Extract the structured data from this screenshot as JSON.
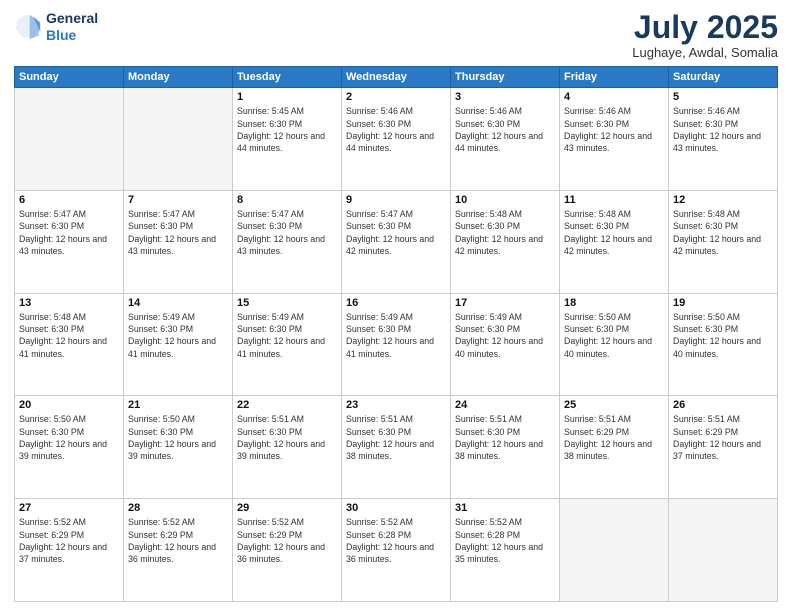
{
  "header": {
    "logo_general": "General",
    "logo_blue": "Blue",
    "month_title": "July 2025",
    "location": "Lughaye, Awdal, Somalia"
  },
  "days_of_week": [
    "Sunday",
    "Monday",
    "Tuesday",
    "Wednesday",
    "Thursday",
    "Friday",
    "Saturday"
  ],
  "weeks": [
    [
      {
        "day": "",
        "info": ""
      },
      {
        "day": "",
        "info": ""
      },
      {
        "day": "1",
        "info": "Sunrise: 5:45 AM\nSunset: 6:30 PM\nDaylight: 12 hours and 44 minutes."
      },
      {
        "day": "2",
        "info": "Sunrise: 5:46 AM\nSunset: 6:30 PM\nDaylight: 12 hours and 44 minutes."
      },
      {
        "day": "3",
        "info": "Sunrise: 5:46 AM\nSunset: 6:30 PM\nDaylight: 12 hours and 44 minutes."
      },
      {
        "day": "4",
        "info": "Sunrise: 5:46 AM\nSunset: 6:30 PM\nDaylight: 12 hours and 43 minutes."
      },
      {
        "day": "5",
        "info": "Sunrise: 5:46 AM\nSunset: 6:30 PM\nDaylight: 12 hours and 43 minutes."
      }
    ],
    [
      {
        "day": "6",
        "info": "Sunrise: 5:47 AM\nSunset: 6:30 PM\nDaylight: 12 hours and 43 minutes."
      },
      {
        "day": "7",
        "info": "Sunrise: 5:47 AM\nSunset: 6:30 PM\nDaylight: 12 hours and 43 minutes."
      },
      {
        "day": "8",
        "info": "Sunrise: 5:47 AM\nSunset: 6:30 PM\nDaylight: 12 hours and 43 minutes."
      },
      {
        "day": "9",
        "info": "Sunrise: 5:47 AM\nSunset: 6:30 PM\nDaylight: 12 hours and 42 minutes."
      },
      {
        "day": "10",
        "info": "Sunrise: 5:48 AM\nSunset: 6:30 PM\nDaylight: 12 hours and 42 minutes."
      },
      {
        "day": "11",
        "info": "Sunrise: 5:48 AM\nSunset: 6:30 PM\nDaylight: 12 hours and 42 minutes."
      },
      {
        "day": "12",
        "info": "Sunrise: 5:48 AM\nSunset: 6:30 PM\nDaylight: 12 hours and 42 minutes."
      }
    ],
    [
      {
        "day": "13",
        "info": "Sunrise: 5:48 AM\nSunset: 6:30 PM\nDaylight: 12 hours and 41 minutes."
      },
      {
        "day": "14",
        "info": "Sunrise: 5:49 AM\nSunset: 6:30 PM\nDaylight: 12 hours and 41 minutes."
      },
      {
        "day": "15",
        "info": "Sunrise: 5:49 AM\nSunset: 6:30 PM\nDaylight: 12 hours and 41 minutes."
      },
      {
        "day": "16",
        "info": "Sunrise: 5:49 AM\nSunset: 6:30 PM\nDaylight: 12 hours and 41 minutes."
      },
      {
        "day": "17",
        "info": "Sunrise: 5:49 AM\nSunset: 6:30 PM\nDaylight: 12 hours and 40 minutes."
      },
      {
        "day": "18",
        "info": "Sunrise: 5:50 AM\nSunset: 6:30 PM\nDaylight: 12 hours and 40 minutes."
      },
      {
        "day": "19",
        "info": "Sunrise: 5:50 AM\nSunset: 6:30 PM\nDaylight: 12 hours and 40 minutes."
      }
    ],
    [
      {
        "day": "20",
        "info": "Sunrise: 5:50 AM\nSunset: 6:30 PM\nDaylight: 12 hours and 39 minutes."
      },
      {
        "day": "21",
        "info": "Sunrise: 5:50 AM\nSunset: 6:30 PM\nDaylight: 12 hours and 39 minutes."
      },
      {
        "day": "22",
        "info": "Sunrise: 5:51 AM\nSunset: 6:30 PM\nDaylight: 12 hours and 39 minutes."
      },
      {
        "day": "23",
        "info": "Sunrise: 5:51 AM\nSunset: 6:30 PM\nDaylight: 12 hours and 38 minutes."
      },
      {
        "day": "24",
        "info": "Sunrise: 5:51 AM\nSunset: 6:30 PM\nDaylight: 12 hours and 38 minutes."
      },
      {
        "day": "25",
        "info": "Sunrise: 5:51 AM\nSunset: 6:29 PM\nDaylight: 12 hours and 38 minutes."
      },
      {
        "day": "26",
        "info": "Sunrise: 5:51 AM\nSunset: 6:29 PM\nDaylight: 12 hours and 37 minutes."
      }
    ],
    [
      {
        "day": "27",
        "info": "Sunrise: 5:52 AM\nSunset: 6:29 PM\nDaylight: 12 hours and 37 minutes."
      },
      {
        "day": "28",
        "info": "Sunrise: 5:52 AM\nSunset: 6:29 PM\nDaylight: 12 hours and 36 minutes."
      },
      {
        "day": "29",
        "info": "Sunrise: 5:52 AM\nSunset: 6:29 PM\nDaylight: 12 hours and 36 minutes."
      },
      {
        "day": "30",
        "info": "Sunrise: 5:52 AM\nSunset: 6:28 PM\nDaylight: 12 hours and 36 minutes."
      },
      {
        "day": "31",
        "info": "Sunrise: 5:52 AM\nSunset: 6:28 PM\nDaylight: 12 hours and 35 minutes."
      },
      {
        "day": "",
        "info": ""
      },
      {
        "day": "",
        "info": ""
      }
    ]
  ]
}
